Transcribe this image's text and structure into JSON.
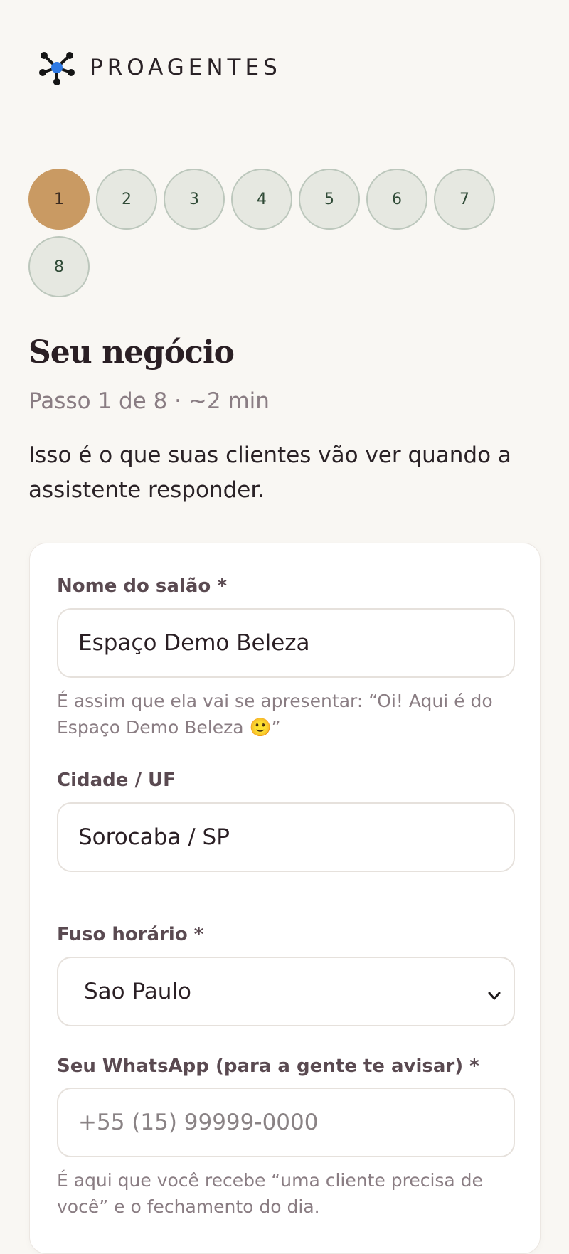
{
  "header": {
    "brand": "PROAGENTES",
    "logo_icon": "network-nodes-icon",
    "accent": "#2f7ae5"
  },
  "steps": {
    "items": [
      "1",
      "2",
      "3",
      "4",
      "5",
      "6",
      "7",
      "8"
    ],
    "current": 1
  },
  "page": {
    "title": "Seu negócio",
    "subtitle": "Passo 1 de 8 · ~2 min",
    "intro": "Isso é o que suas clientes vão ver quando a assistente responder."
  },
  "form": {
    "salon_name": {
      "label": "Nome do salão *",
      "value": "Espaço Demo Beleza",
      "help": "É assim que ela vai se apresentar: “Oi! Aqui é do Espaço Demo Beleza 🙂”"
    },
    "city": {
      "label": "Cidade / UF",
      "value": "Sorocaba / SP"
    },
    "timezone": {
      "label": "Fuso horário *",
      "value": "Sao Paulo",
      "icon": "chevron-down-icon"
    },
    "whatsapp": {
      "label": "Seu WhatsApp (para a gente te avisar) *",
      "value": "",
      "placeholder": "+55 (15) 99999-0000",
      "help": "É aqui que você recebe “uma cliente precisa de você” e o fechamento do dia."
    }
  },
  "colors": {
    "background": "#f9f7f3",
    "active_step": "#c99a63",
    "inactive_step": "#e6e8e1"
  }
}
